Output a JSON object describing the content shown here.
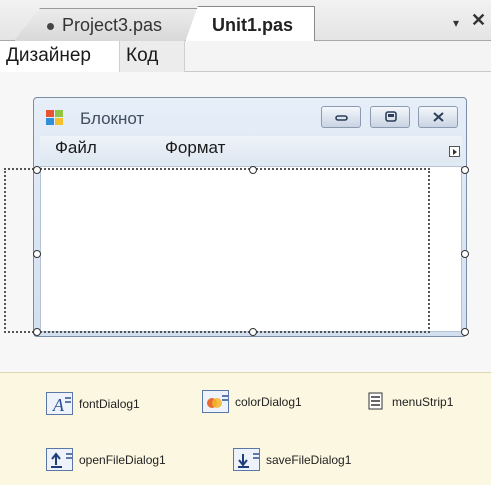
{
  "tabs": {
    "project": "Project3.pas",
    "unit": "Unit1.pas",
    "pin_icon": "▾",
    "close_icon": "✕"
  },
  "subtabs": {
    "designer": "Дизайнер",
    "code": "Код"
  },
  "form": {
    "title": "Блокнот",
    "menu": [
      "Файл",
      "Формат"
    ]
  },
  "components": [
    {
      "label": "fontDialog1",
      "icon": "font-dialog-icon"
    },
    {
      "label": "colorDialog1",
      "icon": "color-dialog-icon"
    },
    {
      "label": "menuStrip1",
      "icon": "menu-strip-icon"
    },
    {
      "label": "openFileDialog1",
      "icon": "open-file-dialog-icon"
    },
    {
      "label": "saveFileDialog1",
      "icon": "save-file-dialog-icon"
    }
  ]
}
